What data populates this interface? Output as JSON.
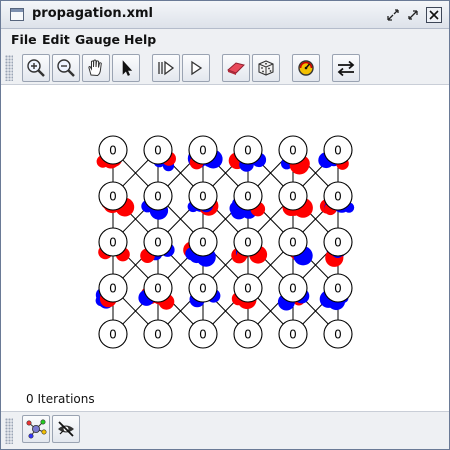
{
  "window": {
    "title": "propagation.xml",
    "icon": "window-icon",
    "controls": [
      "restore-icon",
      "maximize-icon",
      "close-icon"
    ]
  },
  "menubar": {
    "items": [
      "File",
      "Edit",
      "Gauge",
      "Help"
    ]
  },
  "toolbar": {
    "buttons": [
      {
        "name": "zoom-in-button",
        "icon": "zoom-in-icon"
      },
      {
        "name": "zoom-out-button",
        "icon": "zoom-out-icon"
      },
      {
        "name": "pan-button",
        "icon": "hand-icon"
      },
      {
        "name": "select-button",
        "icon": "arrow-cursor-icon"
      },
      {
        "name": "step-button",
        "icon": "step-forward-icon"
      },
      {
        "name": "play-button",
        "icon": "play-icon"
      },
      {
        "name": "erase-button",
        "icon": "eraser-icon"
      },
      {
        "name": "randomize-button",
        "icon": "dice-icon"
      },
      {
        "name": "gauge-button",
        "icon": "gauge-icon"
      },
      {
        "name": "swap-button",
        "icon": "swap-arrows-icon"
      }
    ]
  },
  "network": {
    "node_value": "0",
    "rows": 5,
    "cols": 6,
    "colors": {
      "negative": "#0000ff",
      "positive": "#ff0000",
      "edge": "#000000",
      "node_fill": "#ffffff"
    }
  },
  "status": {
    "iterations": "0 Iterations"
  },
  "bottombar": {
    "buttons": [
      {
        "name": "network-view-button",
        "icon": "network-color-icon"
      },
      {
        "name": "hide-view-button",
        "icon": "hidden-eye-icon"
      }
    ]
  }
}
